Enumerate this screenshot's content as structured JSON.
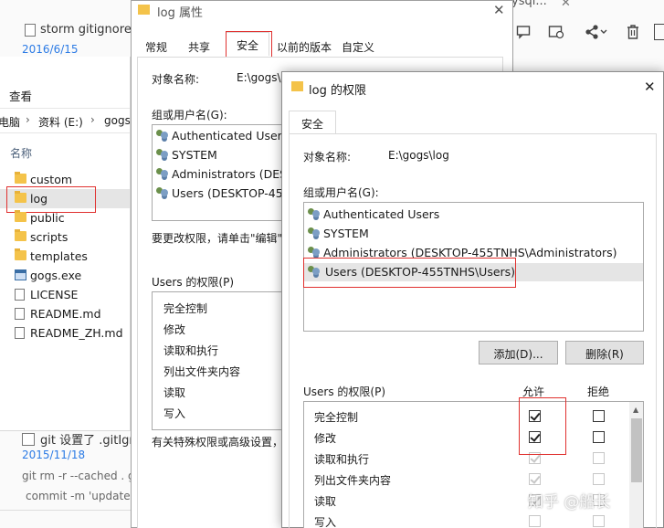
{
  "blog": {
    "entry1_title": "storm gitignore",
    "entry1_date": "2016/6/15",
    "entry2_title": "git 设置了 .gitIgno",
    "entry2_date": "2015/11/18",
    "entry2_line1": "git rm -r --cached . g",
    "entry2_line2": "commit -m 'update",
    "top_fragment": "ysql...",
    "toolbar_icons": [
      "comment-icon",
      "history-icon",
      "share-icon",
      "trash-icon"
    ]
  },
  "explorer": {
    "view_label": "查看",
    "path": [
      "电脑",
      "资料 (E:)",
      "gogs"
    ],
    "column_name": "名称",
    "items": [
      {
        "name": "custom",
        "type": "folder"
      },
      {
        "name": "log",
        "type": "folder"
      },
      {
        "name": "public",
        "type": "folder"
      },
      {
        "name": "scripts",
        "type": "folder"
      },
      {
        "name": "templates",
        "type": "folder"
      },
      {
        "name": "gogs.exe",
        "type": "exe"
      },
      {
        "name": "LICENSE",
        "type": "file"
      },
      {
        "name": "README.md",
        "type": "file"
      },
      {
        "name": "README_ZH.md",
        "type": "file"
      }
    ]
  },
  "properties": {
    "title": "log 属性",
    "tabs": [
      "常规",
      "共享",
      "安全",
      "以前的版本",
      "自定义"
    ],
    "object_label": "对象名称:",
    "object_value": "E:\\gogs\\",
    "group_label": "组或用户名(G):",
    "users": [
      "Authenticated Users",
      "SYSTEM",
      "Administrators (DES",
      "Users (DESKTOP-455"
    ],
    "change_text": "要更改权限，请单击\"编辑\"",
    "perm_label": "Users 的权限(P)",
    "perms": [
      "完全控制",
      "修改",
      "读取和执行",
      "列出文件夹内容",
      "读取",
      "写入"
    ],
    "special_text": "有关特殊权限或高级设置，"
  },
  "permissions": {
    "title": "log 的权限",
    "tab": "安全",
    "object_label": "对象名称:",
    "object_value": "E:\\gogs\\log",
    "group_label": "组或用户名(G):",
    "users": [
      "Authenticated Users",
      "SYSTEM",
      "Administrators (DESKTOP-455TNHS\\Administrators)",
      "Users (DESKTOP-455TNHS\\Users)"
    ],
    "add_button": "添加(D)...",
    "remove_button": "删除(R)",
    "perm_label": "Users 的权限(P)",
    "allow_header": "允许",
    "deny_header": "拒绝",
    "perms": [
      {
        "name": "完全控制",
        "allow": true,
        "deny": false,
        "inherited": false
      },
      {
        "name": "修改",
        "allow": true,
        "deny": false,
        "inherited": false
      },
      {
        "name": "读取和执行",
        "allow": true,
        "deny": false,
        "inherited": true
      },
      {
        "name": "列出文件夹内容",
        "allow": true,
        "deny": false,
        "inherited": true
      },
      {
        "name": "读取",
        "allow": true,
        "deny": false,
        "inherited": true
      },
      {
        "name": "写入",
        "allow": false,
        "deny": false,
        "inherited": true
      }
    ]
  },
  "watermark": "知乎 @船长",
  "colors": {
    "highlight_box": "#e0312f",
    "selected_row": "#e5e5e5",
    "link_blue": "#2c7be5"
  }
}
